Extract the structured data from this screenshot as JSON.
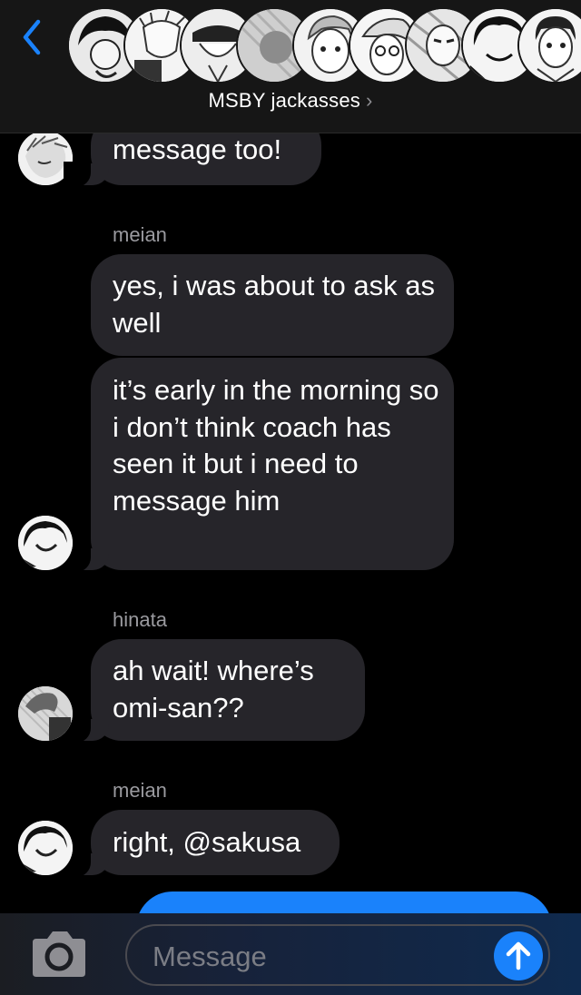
{
  "header": {
    "group_name": "MSBY jackasses",
    "group_chevron": "›",
    "back_icon": "chevron-left-icon",
    "avatar_count": 8
  },
  "messages": [
    {
      "sender": "",
      "text": "message too!"
    },
    {
      "sender": "meian",
      "text": "yes, i was about to ask as well"
    },
    {
      "sender": "",
      "text": "it’s early in the morning so i don’t think coach has seen it but i need to message him"
    },
    {
      "sender": "hinata",
      "text": "ah wait! where’s omi-san??"
    },
    {
      "sender": "meian",
      "text": "right, @sakusa"
    }
  ],
  "input": {
    "placeholder": "Message",
    "camera_icon": "camera-icon",
    "send_icon": "arrow-up-icon"
  },
  "colors": {
    "incoming_bubble": "#26252a",
    "outgoing_bubble": "#1a82fb",
    "accent": "#1a82fb",
    "sender_label": "#9a9a9f",
    "background": "#000000"
  }
}
